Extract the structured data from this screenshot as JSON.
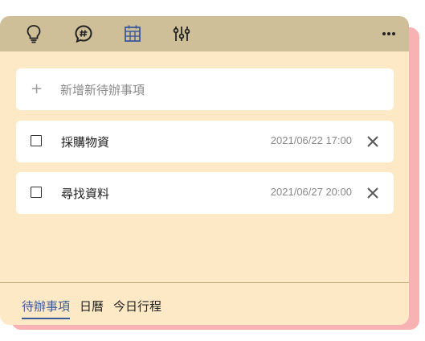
{
  "toolbar": {
    "icons": [
      "lightbulb-icon",
      "hashtag-chat-icon",
      "calendar-icon",
      "sliders-icon"
    ],
    "more_icon": "more-horizontal-icon"
  },
  "add_todo": {
    "plus": "+",
    "placeholder": "新增新待辦事項"
  },
  "todos": [
    {
      "title": "採購物資",
      "datetime": "2021/06/22 17:00",
      "checked": false
    },
    {
      "title": "尋找資料",
      "datetime": "2021/06/27 20:00",
      "checked": false
    }
  ],
  "tabs": [
    {
      "label": "待辦事項",
      "active": true
    },
    {
      "label": "日曆",
      "active": false
    },
    {
      "label": "今日行程",
      "active": false
    }
  ],
  "colors": {
    "toolbar_bg": "#cfbf98",
    "card_bg": "#fde9c6",
    "shadow_card": "#f7b3b3",
    "accent": "#3b5a9a"
  }
}
